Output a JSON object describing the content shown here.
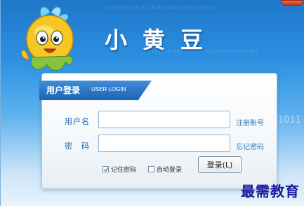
{
  "app": {
    "title": "小黄豆"
  },
  "login": {
    "header_title": "用户登录",
    "header_subtitle": "USER LOGIN",
    "username_label": "用户名",
    "password_label": "密　码",
    "register_link": "注册账号",
    "forgot_link": "忘记密码",
    "remember_label": "记住密码",
    "remember_checked": true,
    "autologin_label": "自动登录",
    "autologin_checked": false,
    "submit_label": "登录(L)"
  },
  "background": {
    "binary_text": "0101010100101101010110101010101101",
    "digits_text": "1011"
  },
  "watermark": "最需教育",
  "colors": {
    "accent": "#1c63b3",
    "link": "#2a7ab0",
    "watermark": "#1a1a99"
  }
}
